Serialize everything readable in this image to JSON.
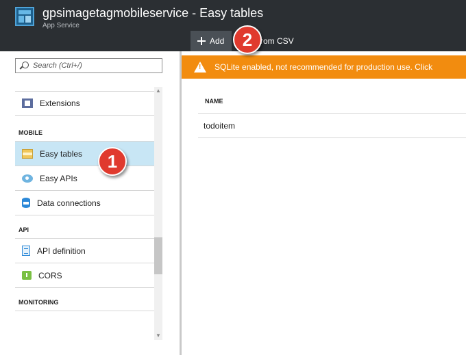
{
  "header": {
    "title": "gpsimagetagmobileservice - Easy tables",
    "subtitle": "App Service",
    "add_label": "Add",
    "csv_label": "ld from CSV"
  },
  "badges": {
    "step1": "1",
    "step2": "2"
  },
  "search": {
    "placeholder": "Search (Ctrl+/)"
  },
  "sidebar": {
    "items": [
      {
        "label": "Extensions",
        "icon": "extensions-icon"
      },
      {
        "section": "MOBILE"
      },
      {
        "label": "Easy tables",
        "icon": "easy-tables-icon",
        "selected": true
      },
      {
        "label": "Easy APIs",
        "icon": "easy-apis-icon"
      },
      {
        "label": "Data connections",
        "icon": "database-icon"
      },
      {
        "section": "API"
      },
      {
        "label": "API definition",
        "icon": "api-definition-icon"
      },
      {
        "label": "CORS",
        "icon": "cors-icon"
      },
      {
        "section": "MONITORING"
      }
    ]
  },
  "warning": {
    "text": "SQLite enabled, not recommended for production use. Click"
  },
  "table": {
    "header": "NAME",
    "rows": [
      "todoitem"
    ]
  },
  "colors": {
    "header_bg": "#2b2f33",
    "warning_bg": "#f28c0f",
    "selected_bg": "#c8e6f5",
    "badge": "#e03a2e"
  }
}
